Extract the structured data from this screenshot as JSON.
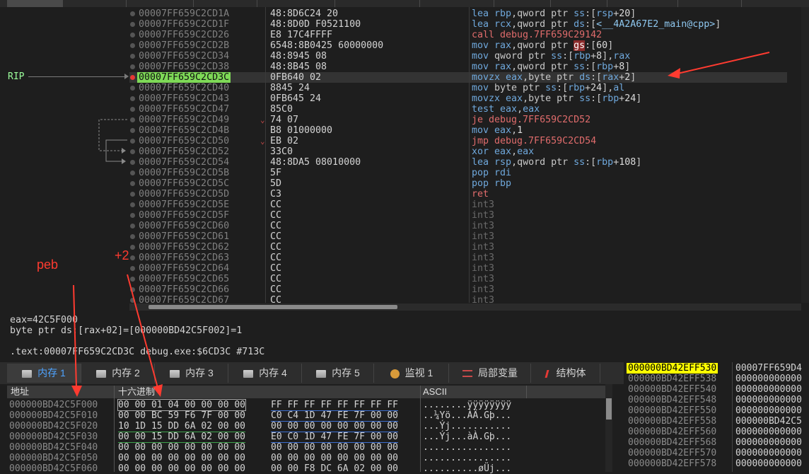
{
  "cpu": {
    "rip_label": "RIP",
    "rows": [
      {
        "addr": "00007FF659C2CD1A",
        "bytes": "48:8D6C24 20",
        "asm": [
          [
            "kw",
            "lea "
          ],
          [
            "reg",
            "rbp"
          ],
          [
            "",
            ","
          ],
          [
            "",
            "qword ptr "
          ],
          [
            "reg",
            "ss"
          ],
          [
            "",
            ":["
          ],
          [
            "reg",
            "rsp"
          ],
          [
            "",
            "+"
          ],
          [
            "num",
            "20"
          ],
          [
            "",
            "]"
          ]
        ]
      },
      {
        "addr": "00007FF659C2CD1F",
        "bytes": "48:8D0D F0521100",
        "asm": [
          [
            "kw",
            "lea "
          ],
          [
            "reg",
            "rcx"
          ],
          [
            "",
            ","
          ],
          [
            "",
            "qword ptr "
          ],
          [
            "reg",
            "ds"
          ],
          [
            "",
            ":["
          ],
          [
            "lbl",
            "<__4A2A67E2_main@cpp>"
          ],
          [
            "",
            "]"
          ]
        ]
      },
      {
        "addr": "00007FF659C2CD26",
        "bytes": "E8 17C4FFFF",
        "asm": [
          [
            "call",
            "call debug.7FF659C29142"
          ]
        ]
      },
      {
        "addr": "00007FF659C2CD2B",
        "bytes": "6548:8B0425 60000000",
        "asm": [
          [
            "kw",
            "mov "
          ],
          [
            "reg",
            "rax"
          ],
          [
            "",
            ","
          ],
          [
            "",
            "qword ptr "
          ],
          [
            "seg",
            "gs"
          ],
          [
            "",
            ":["
          ],
          [
            "num",
            "60"
          ],
          [
            "",
            "]"
          ]
        ]
      },
      {
        "addr": "00007FF659C2CD34",
        "bytes": "48:8945 08",
        "asm": [
          [
            "kw",
            "mov "
          ],
          [
            "",
            "qword ptr "
          ],
          [
            "reg",
            "ss"
          ],
          [
            "",
            ":["
          ],
          [
            "reg",
            "rbp"
          ],
          [
            "",
            "+"
          ],
          [
            "num",
            "8"
          ],
          [
            "",
            "],"
          ],
          [
            "reg",
            "rax"
          ]
        ]
      },
      {
        "addr": "00007FF659C2CD38",
        "bytes": "48:8B45 08",
        "asm": [
          [
            "kw",
            "mov "
          ],
          [
            "reg",
            "rax"
          ],
          [
            "",
            ","
          ],
          [
            "",
            "qword ptr "
          ],
          [
            "reg",
            "ss"
          ],
          [
            "",
            ":["
          ],
          [
            "reg",
            "rbp"
          ],
          [
            "",
            "+"
          ],
          [
            "num",
            "8"
          ],
          [
            "",
            "]"
          ]
        ]
      },
      {
        "addr": "00007FF659C2CD3C",
        "bytes": "0FB640 02",
        "asm": [
          [
            "kw",
            "movzx "
          ],
          [
            "reg",
            "eax"
          ],
          [
            "",
            ","
          ],
          [
            "",
            "byte ptr "
          ],
          [
            "reg",
            "ds"
          ],
          [
            "",
            ":["
          ],
          [
            "reg",
            "rax"
          ],
          [
            "",
            "+"
          ],
          [
            "num",
            "2"
          ],
          [
            "",
            "]"
          ]
        ],
        "current": true,
        "bp": true
      },
      {
        "addr": "00007FF659C2CD40",
        "bytes": "8845 24",
        "asm": [
          [
            "kw",
            "mov "
          ],
          [
            "",
            "byte ptr "
          ],
          [
            "reg",
            "ss"
          ],
          [
            "",
            ":["
          ],
          [
            "reg",
            "rbp"
          ],
          [
            "",
            "+"
          ],
          [
            "num",
            "24"
          ],
          [
            "",
            "],"
          ],
          [
            "reg",
            "al"
          ]
        ]
      },
      {
        "addr": "00007FF659C2CD43",
        "bytes": "0FB645 24",
        "asm": [
          [
            "kw",
            "movzx "
          ],
          [
            "reg",
            "eax"
          ],
          [
            "",
            ","
          ],
          [
            "",
            "byte ptr "
          ],
          [
            "reg",
            "ss"
          ],
          [
            "",
            ":["
          ],
          [
            "reg",
            "rbp"
          ],
          [
            "",
            "+"
          ],
          [
            "num",
            "24"
          ],
          [
            "",
            "]"
          ]
        ]
      },
      {
        "addr": "00007FF659C2CD47",
        "bytes": "85C0",
        "asm": [
          [
            "kw",
            "test "
          ],
          [
            "reg",
            "eax"
          ],
          [
            "",
            ","
          ],
          [
            "reg",
            "eax"
          ]
        ]
      },
      {
        "addr": "00007FF659C2CD49",
        "bytes": "74 07",
        "asm": [
          [
            "jmp",
            "je debug.7FF659C2CD52"
          ]
        ],
        "mark": "⌄"
      },
      {
        "addr": "00007FF659C2CD4B",
        "bytes": "B8 01000000",
        "asm": [
          [
            "kw",
            "mov "
          ],
          [
            "reg",
            "eax"
          ],
          [
            "",
            ","
          ],
          [
            "num",
            "1"
          ]
        ]
      },
      {
        "addr": "00007FF659C2CD50",
        "bytes": "EB 02",
        "asm": [
          [
            "jmp",
            "jmp debug.7FF659C2CD54"
          ]
        ],
        "mark": "⌄"
      },
      {
        "addr": "00007FF659C2CD52",
        "bytes": "33C0",
        "asm": [
          [
            "kw",
            "xor "
          ],
          [
            "reg",
            "eax"
          ],
          [
            "",
            ","
          ],
          [
            "reg",
            "eax"
          ]
        ]
      },
      {
        "addr": "00007FF659C2CD54",
        "bytes": "48:8DA5 08010000",
        "asm": [
          [
            "kw",
            "lea "
          ],
          [
            "reg",
            "rsp"
          ],
          [
            "",
            ","
          ],
          [
            "",
            "qword ptr "
          ],
          [
            "reg",
            "ss"
          ],
          [
            "",
            ":["
          ],
          [
            "reg",
            "rbp"
          ],
          [
            "",
            "+"
          ],
          [
            "num",
            "108"
          ],
          [
            "",
            "]"
          ]
        ]
      },
      {
        "addr": "00007FF659C2CD5B",
        "bytes": "5F",
        "asm": [
          [
            "kw",
            "pop "
          ],
          [
            "reg",
            "rdi"
          ]
        ]
      },
      {
        "addr": "00007FF659C2CD5C",
        "bytes": "5D",
        "asm": [
          [
            "kw",
            "pop "
          ],
          [
            "reg",
            "rbp"
          ]
        ]
      },
      {
        "addr": "00007FF659C2CD5D",
        "bytes": "C3",
        "asm": [
          [
            "call",
            "ret"
          ]
        ]
      },
      {
        "addr": "00007FF659C2CD5E",
        "bytes": "CC",
        "asm": [
          [
            "dim",
            "int3"
          ]
        ]
      },
      {
        "addr": "00007FF659C2CD5F",
        "bytes": "CC",
        "asm": [
          [
            "dim",
            "int3"
          ]
        ]
      },
      {
        "addr": "00007FF659C2CD60",
        "bytes": "CC",
        "asm": [
          [
            "dim",
            "int3"
          ]
        ]
      },
      {
        "addr": "00007FF659C2CD61",
        "bytes": "CC",
        "asm": [
          [
            "dim",
            "int3"
          ]
        ]
      },
      {
        "addr": "00007FF659C2CD62",
        "bytes": "CC",
        "asm": [
          [
            "dim",
            "int3"
          ]
        ]
      },
      {
        "addr": "00007FF659C2CD63",
        "bytes": "CC",
        "asm": [
          [
            "dim",
            "int3"
          ]
        ]
      },
      {
        "addr": "00007FF659C2CD64",
        "bytes": "CC",
        "asm": [
          [
            "dim",
            "int3"
          ]
        ]
      },
      {
        "addr": "00007FF659C2CD65",
        "bytes": "CC",
        "asm": [
          [
            "dim",
            "int3"
          ]
        ]
      },
      {
        "addr": "00007FF659C2CD66",
        "bytes": "CC",
        "asm": [
          [
            "dim",
            "int3"
          ]
        ]
      },
      {
        "addr": "00007FF659C2CD67",
        "bytes": "CC",
        "asm": [
          [
            "dim",
            "int3"
          ]
        ]
      }
    ]
  },
  "info": {
    "line1": "eax=42C5F000",
    "line2": "byte ptr ds:[rax+02]=[000000BD42C5F002]=1",
    "line3": ".text:00007FF659C2CD3C debug.exe:$6CD3C #713C"
  },
  "tabs": [
    {
      "label": "内存 1",
      "icon": "memory-icon",
      "active": true
    },
    {
      "label": "内存 2",
      "icon": "memory-icon"
    },
    {
      "label": "内存 3",
      "icon": "memory-icon"
    },
    {
      "label": "内存 4",
      "icon": "memory-icon"
    },
    {
      "label": "内存 5",
      "icon": "memory-icon"
    },
    {
      "label": "监视 1",
      "icon": "watch-icon"
    },
    {
      "label": "局部变量",
      "icon": "locals-icon"
    },
    {
      "label": "结构体",
      "icon": "struct-icon"
    }
  ],
  "dump": {
    "headers": {
      "addr": "地址",
      "hex": "十六进制",
      "ascii": "ASCII"
    },
    "rows": [
      {
        "addr": "000000BD42C5F000",
        "h1": "00 00 01 04 00 00 00 00",
        "h2": "FF FF FF FF FF FF FF FF",
        "ascii": "........ÿÿÿÿÿÿÿÿ"
      },
      {
        "addr": "000000BD42C5F010",
        "h1": "00 00 BC 59 F6 7F 00 00",
        "h2": "C0 C4 1D 47 FE 7F 00 00",
        "ascii": "..¼Yö...ÀÄ.Gþ..."
      },
      {
        "addr": "000000BD42C5F020",
        "h1": "10 1D 15 DD 6A 02 00 00",
        "h2": "00 00 00 00 00 00 00 00",
        "ascii": "...Ýj..........."
      },
      {
        "addr": "000000BD42C5F030",
        "h1": "00 00 15 DD 6A 02 00 00",
        "h2": "E0 C0 1D 47 FE 7F 00 00",
        "ascii": "...Ýj...àÀ.Gþ..."
      },
      {
        "addr": "000000BD42C5F040",
        "h1": "00 00 00 00 00 00 00 00",
        "h2": "00 00 00 00 00 00 00 00",
        "ascii": "................"
      },
      {
        "addr": "000000BD42C5F050",
        "h1": "00 00 00 00 00 00 00 00",
        "h2": "00 00 00 00 00 00 00 00",
        "ascii": "................"
      },
      {
        "addr": "000000BD42C5F060",
        "h1": "00 00 00 00 00 00 00 00",
        "h2": "00 00 F8 DC 6A 02 00 00",
        "ascii": "..........øÜj..."
      }
    ]
  },
  "stack": {
    "rows": [
      {
        "addr": "000000BD42EFF530",
        "val": "00007FF659D4",
        "current": true
      },
      {
        "addr": "000000BD42EFF538",
        "val": "000000000000"
      },
      {
        "addr": "000000BD42EFF540",
        "val": "000000000000"
      },
      {
        "addr": "000000BD42EFF548",
        "val": "000000000000"
      },
      {
        "addr": "000000BD42EFF550",
        "val": "000000000000"
      },
      {
        "addr": "000000BD42EFF558",
        "val": "000000BD42C5"
      },
      {
        "addr": "000000BD42EFF560",
        "val": "000000000000"
      },
      {
        "addr": "000000BD42EFF568",
        "val": "000000000000"
      },
      {
        "addr": "000000BD42EFF570",
        "val": "000000000000"
      },
      {
        "addr": "000000BD42EFF578",
        "val": "000000000000"
      }
    ]
  },
  "annotations": {
    "peb": "peb",
    "plus2": "+2"
  },
  "colors": {
    "accent": "#4ea3ff",
    "annotation": "#ff3b30",
    "rip_highlight": "#7ed957",
    "stack_highlight": "#ffff00"
  }
}
